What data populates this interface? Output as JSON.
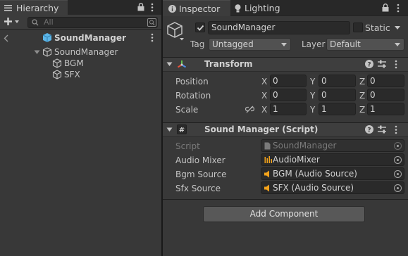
{
  "hierarchy": {
    "tab_label": "Hierarchy",
    "search_placeholder": "All",
    "scene_name": "SoundManager",
    "root_object": "SoundManager",
    "children": [
      {
        "label": "BGM"
      },
      {
        "label": "SFX"
      }
    ]
  },
  "inspector": {
    "tab_label": "Inspector",
    "lighting_tab_label": "Lighting",
    "object_name": "SoundManager",
    "static_label": "Static",
    "tag_label": "Tag",
    "tag_value": "Untagged",
    "layer_label": "Layer",
    "layer_value": "Default",
    "transform": {
      "title": "Transform",
      "rows": [
        {
          "label": "Position",
          "x": "0",
          "y": "0",
          "z": "0"
        },
        {
          "label": "Rotation",
          "x": "0",
          "y": "0",
          "z": "0"
        },
        {
          "label": "Scale",
          "x": "1",
          "y": "1",
          "z": "1"
        }
      ],
      "axis_x": "X",
      "axis_y": "Y",
      "axis_z": "Z"
    },
    "script_component": {
      "title": "Sound Manager (Script)",
      "script_label": "Script",
      "script_value": "SoundManager",
      "fields": [
        {
          "label": "Audio Mixer",
          "value": "AudioMixer"
        },
        {
          "label": "Bgm Source",
          "value": "BGM (Audio Source)"
        },
        {
          "label": "Sfx Source",
          "value": "SFX (Audio Source)"
        }
      ]
    },
    "add_component_label": "Add Component"
  },
  "colors": {
    "panel_bg": "#383838",
    "header_bg": "#3e3e3e",
    "field_bg": "#2a2a2a",
    "cube_blue": "#5cb6e8",
    "transform_red": "#e8533b",
    "transform_green": "#68c24f",
    "transform_blue": "#4f8ee8",
    "audio_orange": "#f2a21b"
  }
}
